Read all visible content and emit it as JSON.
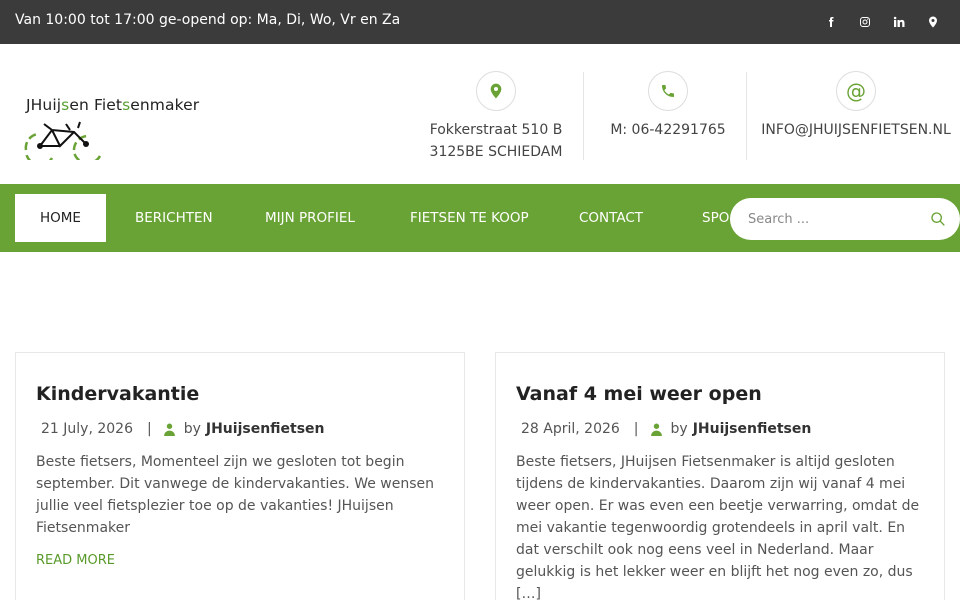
{
  "topbar": {
    "hours_text": "Van 10:00 tot 17:00 ge-opend op: Ma, Di, Wo, Vr en Za",
    "social": [
      "facebook-icon",
      "instagram-icon",
      "linkedin-icon",
      "map-pin-icon"
    ]
  },
  "logo": {
    "part1": "JHuij",
    "part2": "s",
    "part3": "en Fiet",
    "part4": "s",
    "part5": "enmaker"
  },
  "contact": {
    "address_line1": "Fokkerstraat 510 B",
    "address_line2": "3125BE SCHIEDAM",
    "phone": "M: 06-42291765",
    "email": "INFO@JHUIJSENFIETSEN.NL"
  },
  "nav": {
    "items": [
      "HOME",
      "BERICHTEN",
      "MIJN PROFIEL",
      "FIETSEN TE KOOP",
      "CONTACT",
      "SPO"
    ],
    "search_placeholder": "Search ..."
  },
  "posts": [
    {
      "title": "Kindervakantie",
      "date": "21 July, 2026",
      "separator": "|",
      "by": "by",
      "author": "JHuijsenfietsen",
      "excerpt": "Beste fietsers, Momenteel zijn we gesloten tot begin september. Dit vanwege de kindervakanties. We wensen jullie veel fietsplezier toe op de vakanties! JHuijsen Fietsenmaker",
      "read_more": "READ MORE"
    },
    {
      "title": "Vanaf 4 mei weer open",
      "date": "28 April, 2026",
      "separator": "|",
      "by": "by",
      "author": "JHuijsenfietsen",
      "excerpt": "Beste fietsers, JHuijsen Fietsenmaker is altijd gesloten tijdens de kindervakanties. Daarom zijn wij vanaf 4 mei weer open. Er was even een beetje verwarring, omdat de mei vakantie tegenwoordig grotendeels in april valt. En dat verschilt ook nog eens veel in Nederland. Maar gelukkig is het lekker weer en blijft het nog even zo, dus […]"
    }
  ],
  "colors": {
    "accent": "#6aa335",
    "topbar": "#3b3b3b"
  }
}
